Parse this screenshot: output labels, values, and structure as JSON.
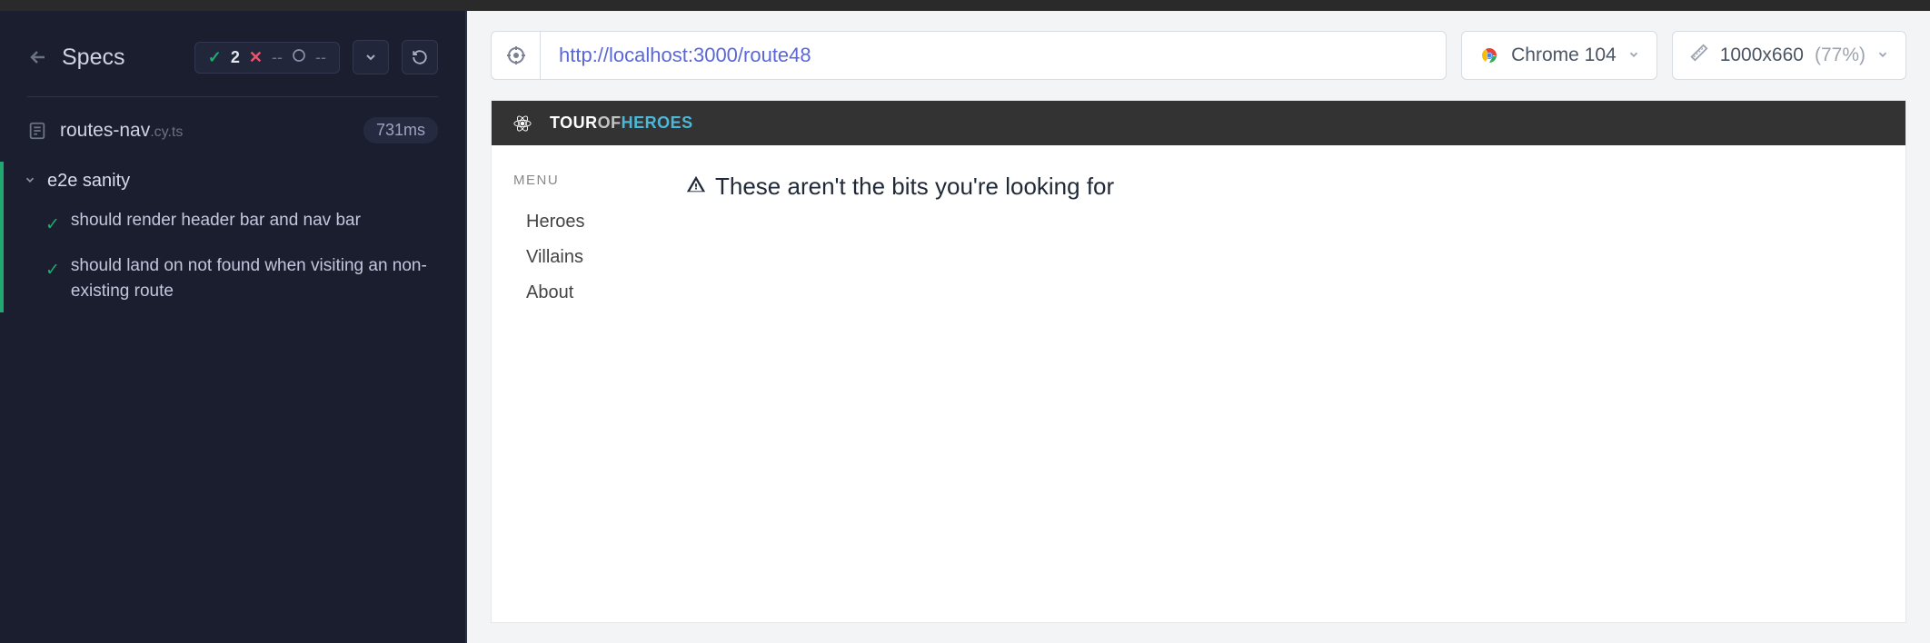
{
  "sidebar": {
    "specs_title": "Specs",
    "stats": {
      "passed": "2",
      "failed": "--",
      "pending": "--"
    },
    "spec_file": {
      "name": "routes-nav",
      "ext": ".cy.ts",
      "duration": "731ms"
    },
    "suite": {
      "name": "e2e sanity",
      "tests": [
        "should render header bar and nav bar",
        "should land on not found when visiting an non-existing route"
      ]
    }
  },
  "toolbar": {
    "url": "http://localhost:3000/route48",
    "browser": "Chrome 104",
    "viewport_size": "1000x660",
    "viewport_scale": "(77%)"
  },
  "app": {
    "brand_tour": "TOUR",
    "brand_of": "OF",
    "brand_heroes": "HEROES",
    "menu_label": "MENU",
    "menu_items": [
      "Heroes",
      "Villains",
      "About"
    ],
    "notfound_text": "These aren't the bits you're looking for"
  }
}
